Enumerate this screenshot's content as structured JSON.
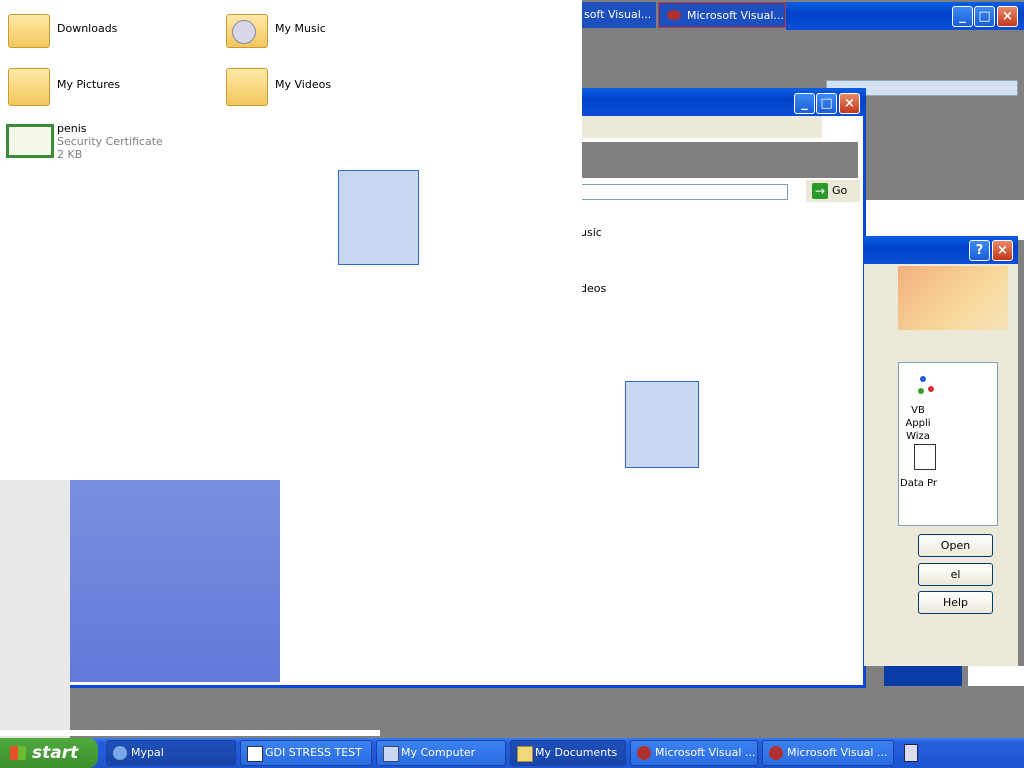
{
  "desktop": {
    "icons": [
      {
        "label": "Downloads",
        "icon": "folder-icon"
      },
      {
        "label": "My Music",
        "icon": "music-folder-icon"
      },
      {
        "label": "My Pictures",
        "icon": "pictures-folder-icon"
      },
      {
        "label": "My Videos",
        "icon": "videos-folder-icon"
      },
      {
        "label": "penis",
        "sub1": "Security Certificate",
        "sub2": "2 KB",
        "icon": "certificate-icon"
      }
    ]
  },
  "background_windows": {
    "top_tabs": [
      "soft Visual...",
      "Microsoft Visual..."
    ],
    "partial_labels": [
      "usic",
      "deos"
    ],
    "go_button": "Go"
  },
  "new_project_dialog": {
    "items": [
      "VB Appli Wiza",
      "Data Pr"
    ],
    "buttons": {
      "open": "Open",
      "cancel": "el",
      "help": "Help"
    }
  },
  "taskbar": {
    "start_label": "start",
    "buttons": [
      {
        "label": "Mypal",
        "icon": "mypal-icon"
      },
      {
        "label": "GDI STRESS TEST",
        "icon": "app-icon"
      },
      {
        "label": "My Computer",
        "icon": "computer-icon"
      },
      {
        "label": "My Documents",
        "icon": "documents-icon"
      },
      {
        "label": "Microsoft Visual ...",
        "icon": "visual-studio-icon"
      },
      {
        "label": "Microsoft Visual ...",
        "icon": "visual-studio-icon"
      }
    ]
  },
  "colors": {
    "xp_blue": "#0a5fe4",
    "taskbar": "#245edc",
    "start_green": "#3c8f2e",
    "selection": "#c6d7ef"
  }
}
